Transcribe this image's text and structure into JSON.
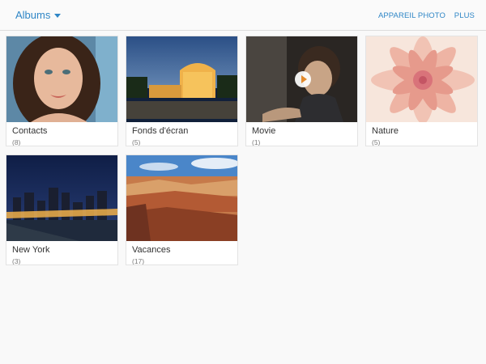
{
  "header": {
    "album_selector": "Albums",
    "actions": [
      "APPAREIL PHOTO",
      "PLUS"
    ]
  },
  "albums": [
    {
      "title": "Contacts",
      "count": "(8)"
    },
    {
      "title": "Fonds d'écran",
      "count": "(5)"
    },
    {
      "title": "Movie",
      "count": "(1)"
    },
    {
      "title": "Nature",
      "count": "(5)"
    },
    {
      "title": "New York",
      "count": "(3)"
    },
    {
      "title": "Vacances",
      "count": "(17)"
    }
  ],
  "colors": {
    "accent": "#2f86c6",
    "background": "#f9f9f9"
  }
}
